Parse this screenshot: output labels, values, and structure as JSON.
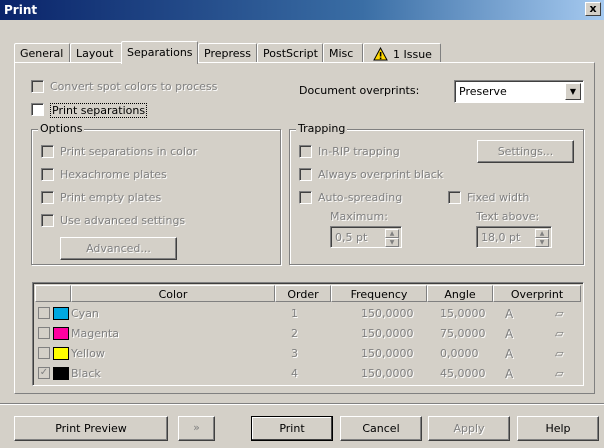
{
  "window": {
    "title": "Print",
    "close_glyph": "x"
  },
  "tabs": [
    {
      "label": "General"
    },
    {
      "label": "Layout"
    },
    {
      "label": "Separations"
    },
    {
      "label": "Prepress"
    },
    {
      "label": "PostScript"
    },
    {
      "label": "Misc"
    },
    {
      "label": "1 Issue"
    }
  ],
  "separations": {
    "convert_spot": "Convert spot colors to process",
    "print_separations": "Print separations",
    "document_overprints_label": "Document overprints:",
    "document_overprints_value": "Preserve"
  },
  "options": {
    "legend": "Options",
    "print_in_color": "Print separations in color",
    "hexachrome": "Hexachrome plates",
    "print_empty": "Print empty plates",
    "use_advanced": "Use advanced settings",
    "advanced_button": "Advanced..."
  },
  "trapping": {
    "legend": "Trapping",
    "in_rip": "In-RIP trapping",
    "settings_button": "Settings...",
    "always_overprint": "Always overprint black",
    "auto_spreading": "Auto-spreading",
    "fixed_width": "Fixed width",
    "maximum_label": "Maximum:",
    "maximum_value": "0,5 pt",
    "text_above_label": "Text above:",
    "text_above_value": "18,0 pt"
  },
  "table": {
    "headers": [
      "Color",
      "Order",
      "Frequency",
      "Angle",
      "Overprint"
    ],
    "rows": [
      {
        "checked": false,
        "color": "Cyan",
        "swatch": "#00a8e0",
        "order": "1",
        "frequency": "150,0000",
        "angle": "15,0000"
      },
      {
        "checked": false,
        "color": "Magenta",
        "swatch": "#ff00a0",
        "order": "2",
        "frequency": "150,0000",
        "angle": "75,0000"
      },
      {
        "checked": false,
        "color": "Yellow",
        "swatch": "#ffff00",
        "order": "3",
        "frequency": "150,0000",
        "angle": "0,0000"
      },
      {
        "checked": true,
        "color": "Black",
        "swatch": "#000000",
        "order": "4",
        "frequency": "150,0000",
        "angle": "45,0000"
      }
    ],
    "overprint_text_icon": "text-overprint-icon",
    "overprint_graphic_icon": "graphic-overprint-icon"
  },
  "buttons": {
    "print_preview": "Print Preview",
    "print": "Print",
    "cancel": "Cancel",
    "apply": "Apply",
    "help": "Help"
  },
  "icons": {
    "warning": "warning-icon",
    "expand_preview": "double-arrow-icon"
  }
}
